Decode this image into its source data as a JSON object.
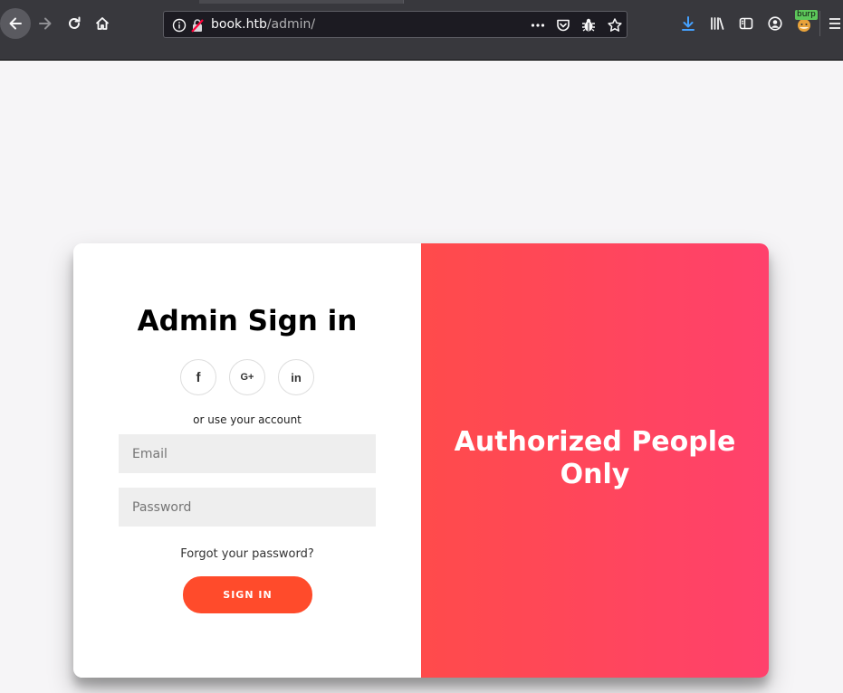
{
  "browser": {
    "url_host": "book.htb",
    "url_path": "/admin/",
    "burp_label": "burp"
  },
  "form": {
    "title": "Admin Sign in",
    "social": [
      {
        "icon": "facebook-icon",
        "glyph": "f"
      },
      {
        "icon": "google-plus-icon",
        "glyph": "G+"
      },
      {
        "icon": "linkedin-icon",
        "glyph": "in"
      }
    ],
    "hint": "or use your account",
    "email_placeholder": "Email",
    "password_placeholder": "Password",
    "forgot_label": "Forgot your password?",
    "signin_label": "SIGN IN"
  },
  "overlay": {
    "title": "Authorized People Only"
  },
  "colors": {
    "accent": "#ff4b2b",
    "gradient_start": "#ff4b4b",
    "gradient_end": "#ff416c",
    "download_icon": "#45a1ff"
  }
}
